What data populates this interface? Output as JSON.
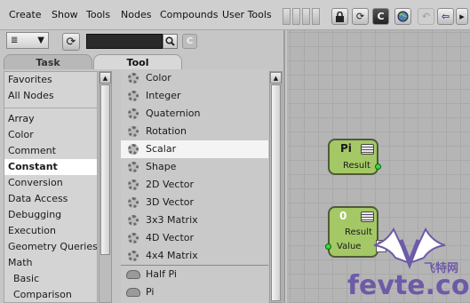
{
  "menubar": {
    "items": [
      "Create",
      "Show",
      "Tools",
      "Nodes",
      "Compounds",
      "User Tools"
    ],
    "toolbar_icons": [
      "lock-icon",
      "refresh-icon",
      "c-icon",
      "globe-icon",
      "undo-icon",
      "back-arrow-icon",
      "forward-icon"
    ],
    "c_label": "C"
  },
  "toolbar": {
    "filter_value": "",
    "search_value": "",
    "clear_label": "C"
  },
  "tabs": [
    {
      "label": "Task",
      "active": false
    },
    {
      "label": "Tool",
      "active": true
    }
  ],
  "categories": {
    "group1": [
      "Favorites",
      "All Nodes"
    ],
    "group2": [
      "Array",
      "Color",
      "Comment",
      "Constant",
      "Conversion",
      "Data Access",
      "Debugging",
      "Execution",
      "Geometry Queries",
      "Math",
      "Basic",
      "Comparison"
    ],
    "selected": "Constant"
  },
  "tools": {
    "items": [
      "Color",
      "Integer",
      "Quaternion",
      "Rotation",
      "Scalar",
      "Shape",
      "2D Vector",
      "3D Vector",
      "3x3 Matrix",
      "4D Vector",
      "4x4 Matrix"
    ],
    "compound_items": [
      "Half Pi",
      "Pi"
    ],
    "selected": "Scalar"
  },
  "graph": {
    "pi_node": {
      "title": "Pi",
      "output": "Result"
    },
    "scalar_node": {
      "title": "0",
      "output": "Result",
      "input": "Value",
      "input_value": "0"
    },
    "node_color": "#a4c865",
    "port_color": "#2ee036"
  },
  "watermark": {
    "text": "fevte.com",
    "chinese": "飞特网"
  }
}
